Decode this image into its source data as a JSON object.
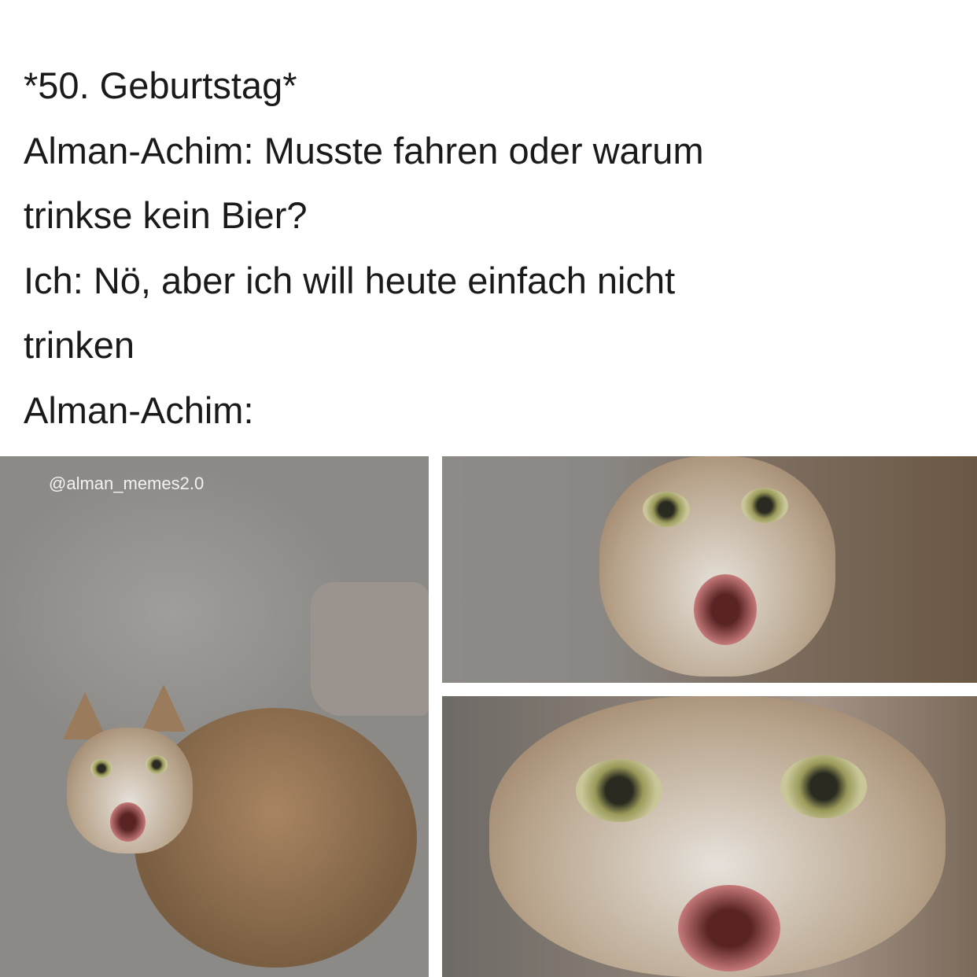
{
  "caption": {
    "lines": [
      "*50. Geburtstag*",
      "Alman-Achim: Musste fahren oder warum",
      "trinkse kein Bier?",
      "Ich: Nö, aber ich will heute einfach nicht",
      "trinken",
      "Alman-Achim:"
    ]
  },
  "watermark": "@alman_memes2.0"
}
